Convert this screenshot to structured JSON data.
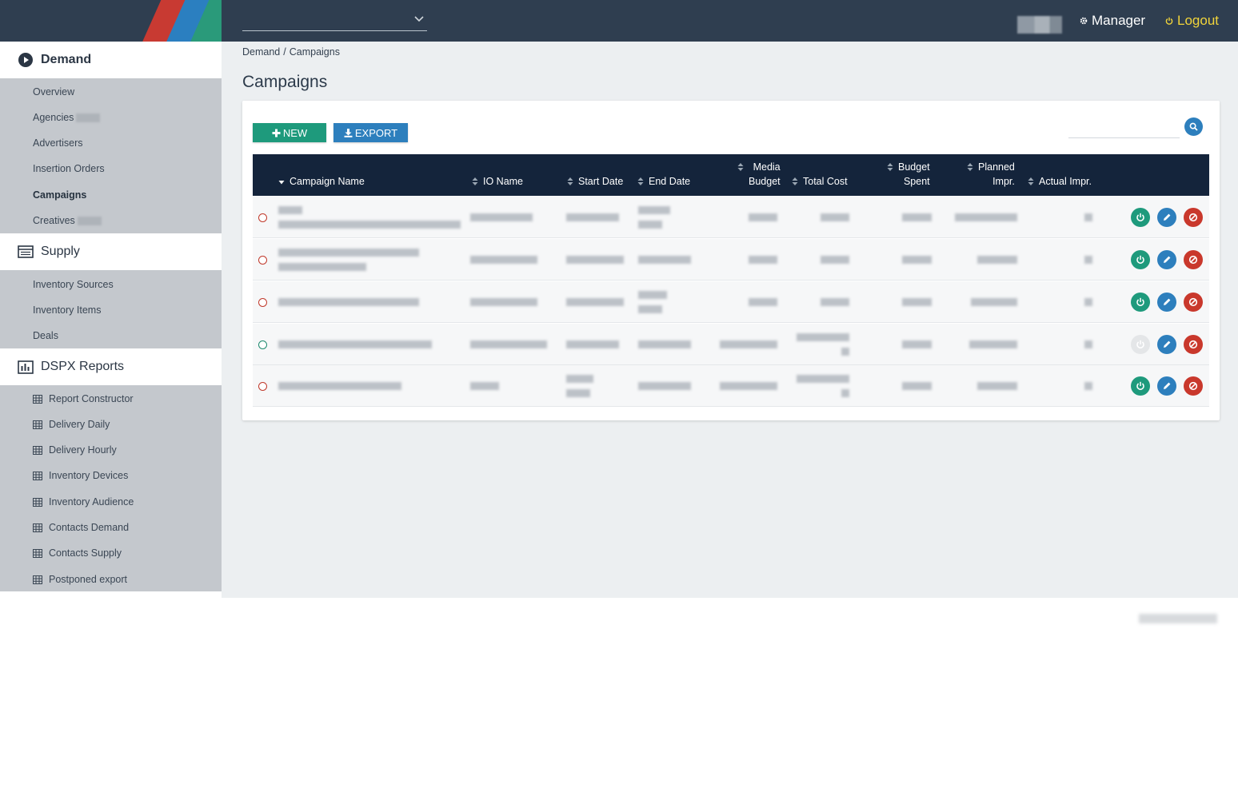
{
  "topbar": {
    "selector_value": "",
    "manager_label": "Manager",
    "logout_label": "Logout",
    "logout_color": "#f1d43a"
  },
  "sidebar": {
    "demand": {
      "title": "Demand",
      "icon": "play-circle-icon",
      "items": [
        {
          "label": "Overview"
        },
        {
          "label": "Agencies"
        },
        {
          "label": "Advertisers"
        },
        {
          "label": "Insertion Orders"
        },
        {
          "label": "Campaigns",
          "active": true
        },
        {
          "label": "Creatives"
        }
      ]
    },
    "supply": {
      "title": "Supply",
      "icon": "list-icon",
      "items": [
        {
          "label": "Inventory Sources"
        },
        {
          "label": "Inventory Items"
        },
        {
          "label": "Deals"
        }
      ]
    },
    "reports": {
      "title": "DSPX Reports",
      "icon": "bar-chart-icon",
      "items": [
        {
          "label": "Report Constructor"
        },
        {
          "label": "Delivery Daily"
        },
        {
          "label": "Delivery Hourly"
        },
        {
          "label": "Inventory Devices"
        },
        {
          "label": "Inventory Audience"
        },
        {
          "label": "Contacts Demand"
        },
        {
          "label": "Contacts Supply"
        },
        {
          "label": "Postponed export"
        }
      ]
    }
  },
  "breadcrumb": {
    "root": "Demand",
    "separator": "/",
    "current": "Campaigns"
  },
  "page": {
    "title": "Campaigns"
  },
  "toolbar": {
    "new_label": "NEW",
    "export_label": "EXPORT",
    "search_placeholder": ""
  },
  "table": {
    "columns": {
      "campaign_name": "Campaign Name",
      "io_name": "IO Name",
      "start_date": "Start Date",
      "end_date": "End Date",
      "media_budget_1": "Media",
      "media_budget_2": "Budget",
      "total_cost": "Total Cost",
      "budget_spent_1": "Budget",
      "budget_spent_2": "Spent",
      "planned_impr_1": "Planned",
      "planned_impr_2": "Impr.",
      "actual_impr": "Actual Impr."
    },
    "rows": [
      {
        "status": "inactive",
        "power": "on"
      },
      {
        "status": "inactive",
        "power": "on"
      },
      {
        "status": "inactive",
        "power": "on"
      },
      {
        "status": "active",
        "power": "off"
      },
      {
        "status": "inactive",
        "power": "on"
      }
    ]
  },
  "colors": {
    "topbar": "#2f3e50",
    "table_header": "#14243b",
    "green": "#1e9a7c",
    "blue": "#2d7fbd",
    "red": "#c9382c"
  }
}
